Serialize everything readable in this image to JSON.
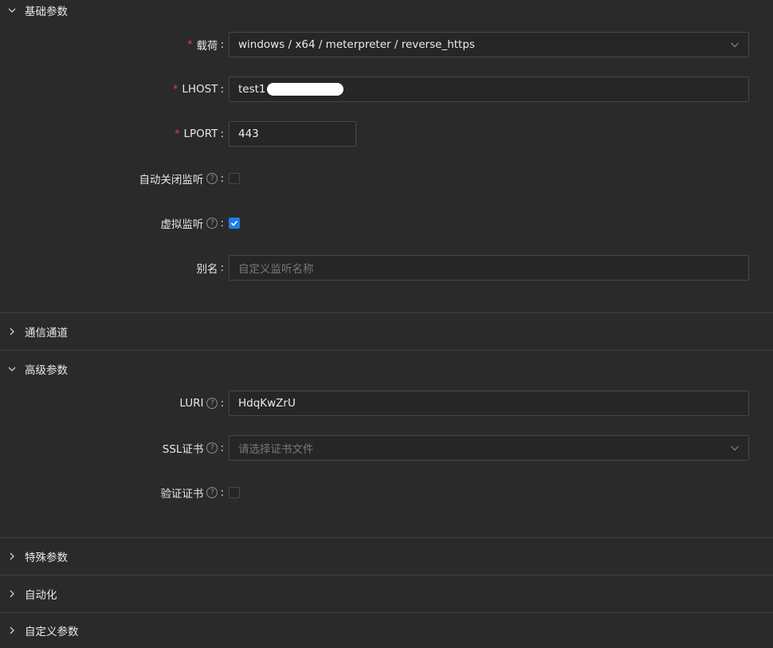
{
  "panels": {
    "basic": {
      "title": "基础参数",
      "expanded": true
    },
    "comm": {
      "title": "通信通道",
      "expanded": false
    },
    "advanced": {
      "title": "高级参数",
      "expanded": true
    },
    "special": {
      "title": "特殊参数",
      "expanded": false
    },
    "automation": {
      "title": "自动化",
      "expanded": false
    },
    "custom": {
      "title": "自定义参数",
      "expanded": false
    }
  },
  "basic": {
    "payload": {
      "label": "载荷",
      "value": "windows / x64 / meterpreter / reverse_https"
    },
    "lhost": {
      "label": "LHOST",
      "value": "test1"
    },
    "lport": {
      "label": "LPORT",
      "value": "443"
    },
    "auto_close": {
      "label": "自动关闭监听",
      "checked": false
    },
    "virtual": {
      "label": "虚拟监听",
      "checked": true
    },
    "alias": {
      "label": "别名",
      "placeholder": "自定义监听名称"
    }
  },
  "advanced": {
    "luri": {
      "label": "LURI",
      "value": "HdqKwZrU"
    },
    "ssl_cert": {
      "label": "SSL证书",
      "placeholder": "请选择证书文件"
    },
    "verify_cert": {
      "label": "验证证书",
      "checked": false
    }
  },
  "colon": ":",
  "help_glyph": "?",
  "required_mark": "*",
  "colors": {
    "background": "#2a2a2a",
    "accent": "#1f7ee8",
    "required": "#e0443e",
    "divider": "#424242"
  }
}
